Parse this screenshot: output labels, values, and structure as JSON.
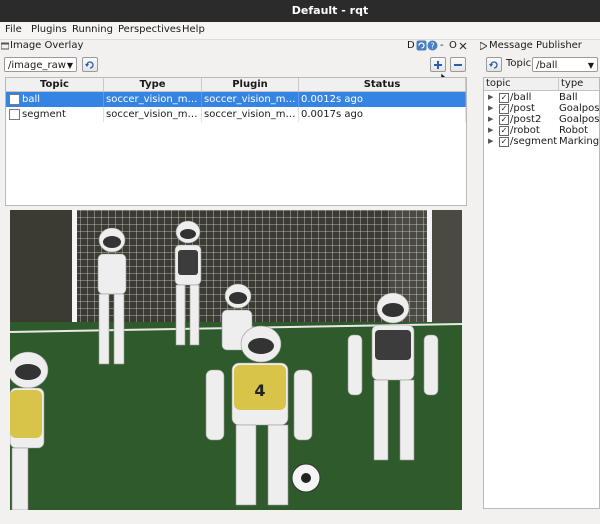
{
  "window": {
    "title": "Default - rqt"
  },
  "menubar": [
    "File",
    "Plugins",
    "Running",
    "Perspectives",
    "Help"
  ],
  "left_panel": {
    "title": "Image Overlay",
    "header_buttons": [
      "D",
      "O"
    ],
    "topic_combo": "/image_raw",
    "table": {
      "columns": [
        "Topic",
        "Type",
        "Plugin",
        "Status"
      ],
      "rows": [
        {
          "topic": "ball",
          "type": "soccer_vision_msg...",
          "plugin": "soccer_vision_msg...",
          "status": "0.0012s ago",
          "selected": true
        },
        {
          "topic": "segment",
          "type": "soccer_vision_msg...",
          "plugin": "soccer_vision_msg...",
          "status": "0.0017s ago",
          "selected": false
        }
      ]
    }
  },
  "right_panel": {
    "title": "Message Publisher",
    "topic_label": "Topic",
    "topic_combo": "/ball",
    "columns": [
      "topic",
      "type"
    ],
    "rows": [
      {
        "topic": "/ball",
        "type": "Ball"
      },
      {
        "topic": "/post",
        "type": "Goalpost"
      },
      {
        "topic": "/post2",
        "type": "Goalpost"
      },
      {
        "topic": "/robot",
        "type": "Robot"
      },
      {
        "topic": "/segment",
        "type": "MarkingS"
      }
    ]
  },
  "image": {
    "jersey_number": "4"
  },
  "colors": {
    "selection": "#3584e4",
    "titlebar": "#2b2b2b",
    "grass": "#2f5a2b",
    "jersey": "#d9c44a"
  }
}
